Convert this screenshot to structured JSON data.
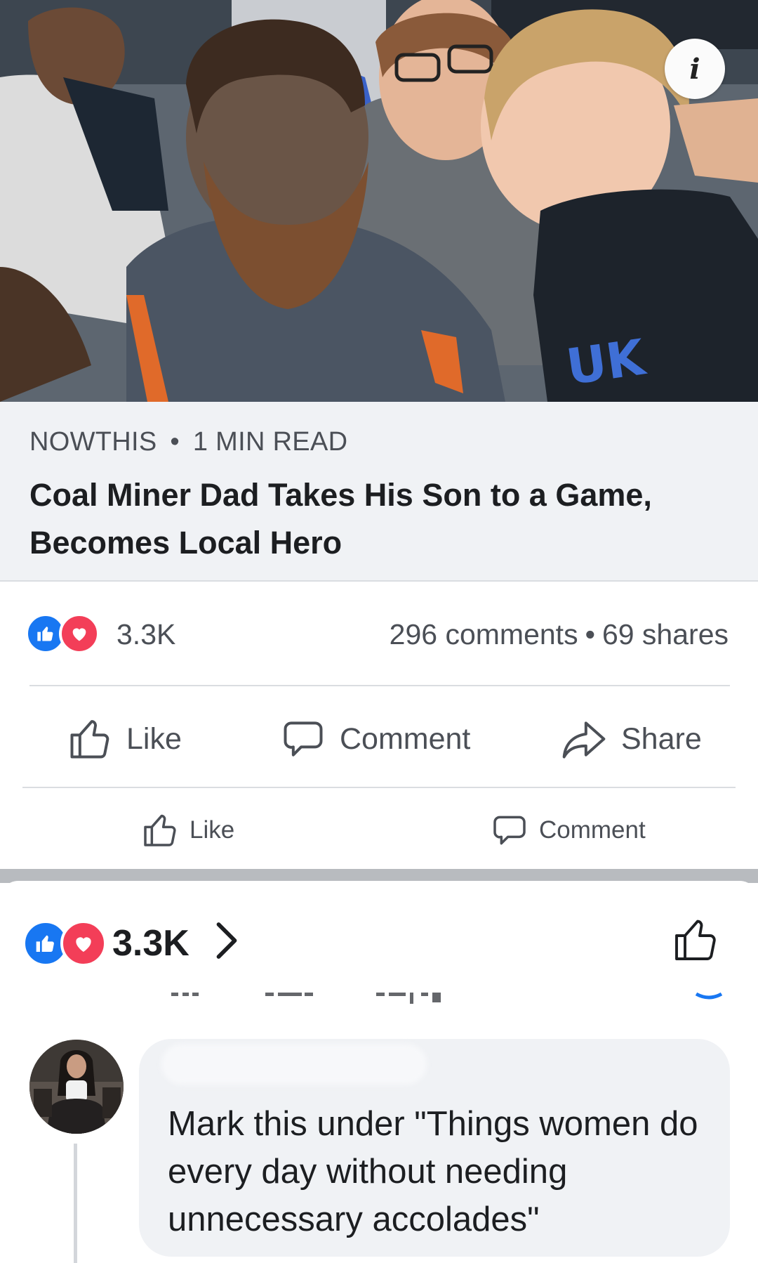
{
  "post": {
    "info_label": "i",
    "article": {
      "source": "NOWTHIS",
      "read_time": "1 MIN READ",
      "title": "Coal Miner Dad Takes His Son to a Game, Becomes Local Hero"
    },
    "stats": {
      "reactions": "3.3K",
      "comments": "296 comments",
      "separator": "•",
      "shares": "69 shares"
    },
    "actions": {
      "like": "Like",
      "comment": "Comment",
      "share": "Share"
    },
    "actions_secondary": {
      "like": "Like",
      "comment": "Comment"
    }
  },
  "reactions_panel": {
    "count": "3.3K"
  },
  "comment": {
    "text": "Mark this under \"Things women do every day without needing unnecessary accolades\""
  },
  "colors": {
    "like_blue": "#1877f2",
    "love_red": "#f33e58",
    "card_bg": "#f0f2f5",
    "secondary_text": "#4b4f56"
  },
  "icons": {
    "info": "info-icon",
    "like": "thumbs-up-outline-icon",
    "comment": "speech-bubble-outline-icon",
    "share": "share-arrow-outline-icon",
    "chevron": "chevron-right-icon",
    "reaction_like": "like-reaction-icon",
    "reaction_love": "love-reaction-icon"
  }
}
